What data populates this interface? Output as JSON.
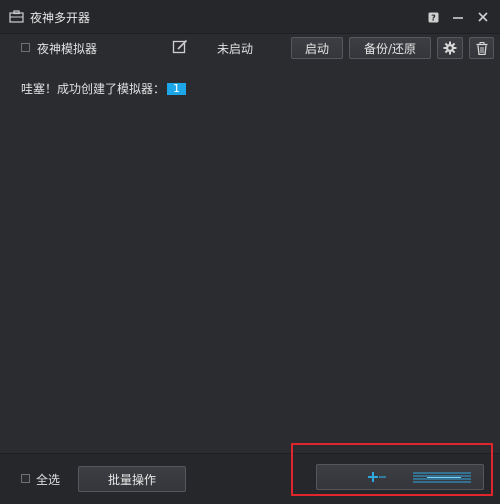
{
  "window": {
    "title": "夜神多开器",
    "icons": [
      "briefcase-icon",
      "help-icon",
      "minimize-icon",
      "close-icon"
    ]
  },
  "emulator_row": {
    "name": "夜神模拟器",
    "status": "未启动",
    "start_label": "启动",
    "backup_label": "备份/还原",
    "icons": [
      "edit-icon",
      "gear-icon",
      "trash-icon"
    ]
  },
  "message": {
    "text": "哇塞！成功创建了模拟器：",
    "count": "1"
  },
  "footer": {
    "select_all_label": "全选",
    "batch_label": "批量操作",
    "add_button_icons": [
      "plus-icon",
      "bars-icon"
    ]
  },
  "colors": {
    "background": "#2b2c30",
    "titlebar": "#26272b",
    "accent": "#1ea7e8",
    "highlight_border": "#e0262c"
  }
}
